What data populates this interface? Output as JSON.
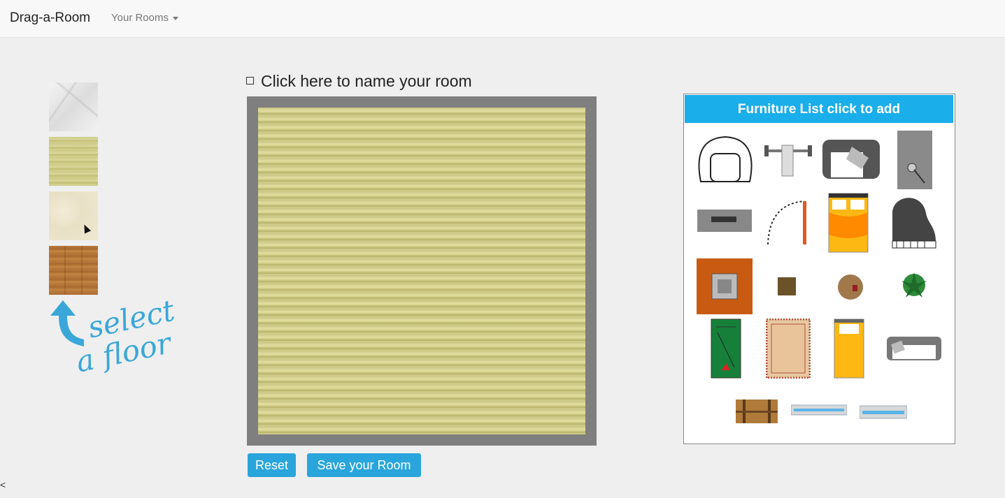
{
  "navbar": {
    "brand": "Drag-a-Room",
    "rooms_menu": "Your Rooms"
  },
  "sidebar": {
    "floors": [
      {
        "name": "marble"
      },
      {
        "name": "tatami"
      },
      {
        "name": "carpet"
      },
      {
        "name": "wood"
      }
    ],
    "hint_line1": "select",
    "hint_line2": "a floor"
  },
  "room": {
    "name_prompt": "Click here to name your room"
  },
  "buttons": {
    "reset": "Reset",
    "save": "Save your Room"
  },
  "furniture": {
    "header": "Furniture List click to add",
    "items": [
      "armchair-icon",
      "weight-bench-icon",
      "corner-chair-icon",
      "mirror-icon",
      "tv-stand-icon",
      "door-icon",
      "double-bed-icon",
      "grand-piano-icon",
      "table-rug-icon",
      "small-table-icon",
      "round-table-icon",
      "plant-icon",
      "pool-table-icon",
      "rug-icon",
      "single-bed-icon",
      "sofa-icon",
      "chest-icon",
      "window-icon",
      "window-small-icon"
    ]
  },
  "colors": {
    "accent": "#2aa5dc",
    "header": "#1aaeea"
  }
}
